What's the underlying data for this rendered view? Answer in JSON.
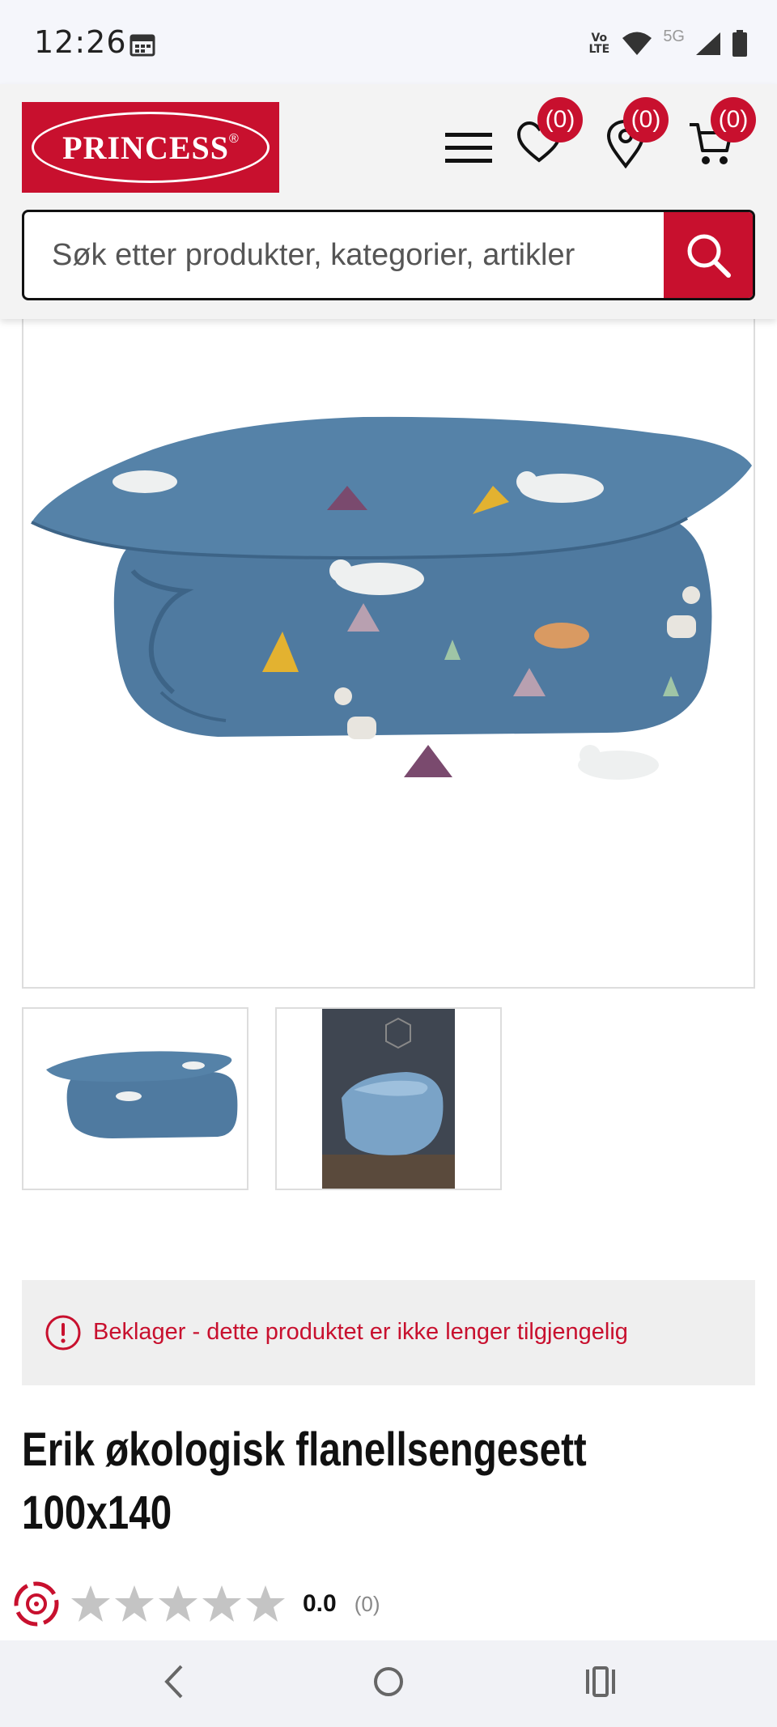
{
  "status_bar": {
    "time": "12:26",
    "network": "5G",
    "volte": "Vo LTE"
  },
  "header": {
    "logo_text": "PRINCESS",
    "logo_mark": "®",
    "wishlist_count": "(0)",
    "stores_count": "(0)",
    "cart_count": "(0)"
  },
  "search": {
    "placeholder": "Søk etter produkter, kategorier, artikler"
  },
  "product": {
    "unavailable_notice": "Beklager - dette produktet er ikke lenger tilgjengelig",
    "title": "Erik økologisk flanellsengesett 100x140",
    "rating_value": "0.0",
    "rating_count": "(0)",
    "rating_stars_filled": 0,
    "rating_stars_total": 5
  },
  "colors": {
    "brand": "#c8102e",
    "duvet_blue": "#4f7aa0"
  },
  "icons": {
    "menu": "hamburger-menu-icon",
    "wishlist": "heart-icon",
    "stores": "map-pin-icon",
    "cart": "cart-icon",
    "search": "search-icon",
    "notice": "exclamation-circle-icon",
    "reviews": "review-logo-icon"
  }
}
